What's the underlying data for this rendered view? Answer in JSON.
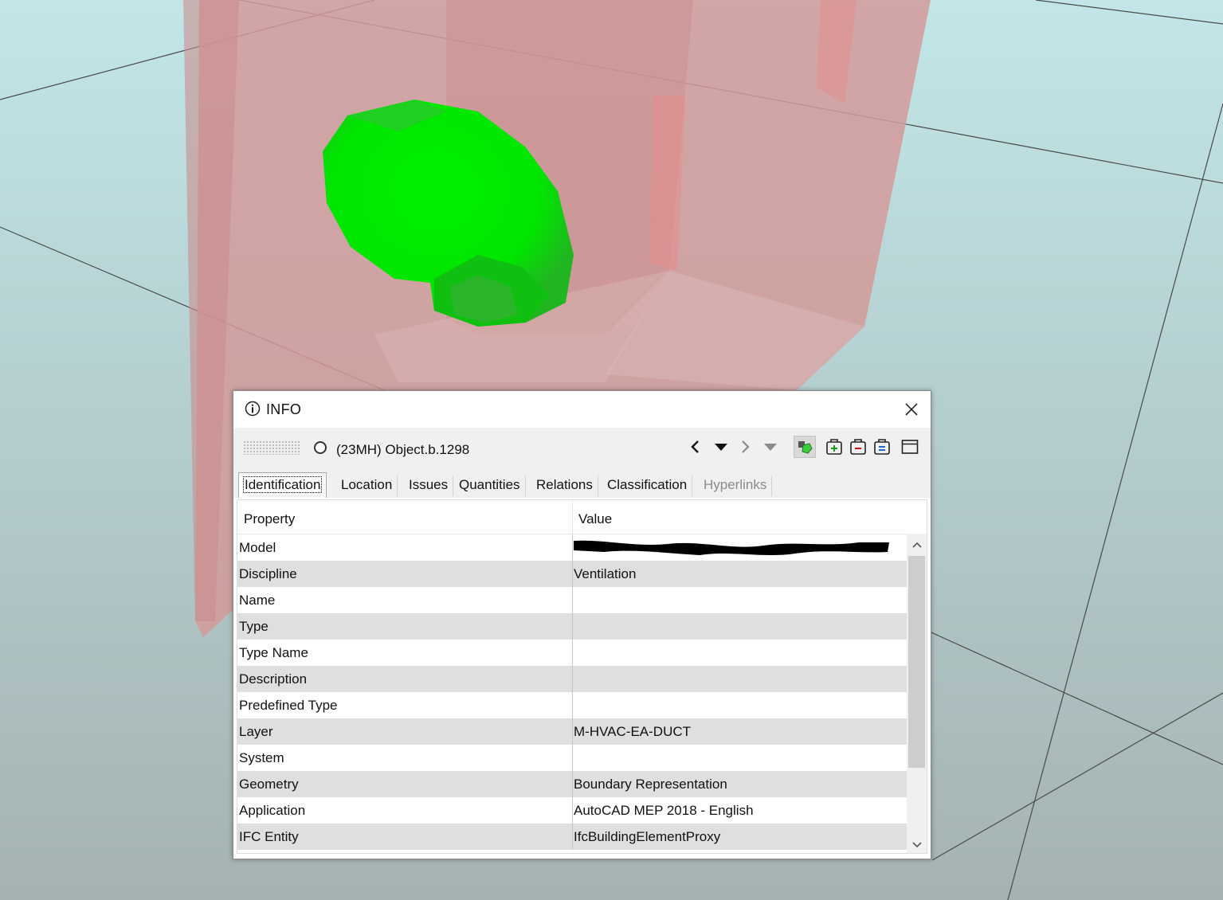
{
  "colors": {
    "sky_top": "#bfe4e6",
    "ground": "#a7b3b3",
    "wall": "#d9a0a0",
    "duct_green": "#00ee00",
    "alt_row": "#dfdfdf"
  },
  "panel": {
    "title": "INFO",
    "title_icon": "info-circle-icon",
    "object_name": "(23MH) Object.b.1298",
    "toolbar_icons": [
      "chevron-left-icon",
      "dropdown-arrow-icon",
      "chevron-right-icon",
      "dropdown-arrow-icon",
      "visibility-toggle-icon",
      "add-selection-icon",
      "remove-selection-icon",
      "list-selection-icon",
      "window-icon"
    ],
    "tabs": [
      {
        "label": "Identification",
        "state": "selected"
      },
      {
        "label": "Location",
        "state": "normal"
      },
      {
        "label": "Issues",
        "state": "normal"
      },
      {
        "label": "Quantities",
        "state": "normal"
      },
      {
        "label": "Relations",
        "state": "normal"
      },
      {
        "label": "Classification",
        "state": "normal"
      },
      {
        "label": "Hyperlinks",
        "state": "disabled"
      }
    ],
    "columns": {
      "property": "Property",
      "value": "Value"
    },
    "rows": [
      {
        "property": "Model",
        "value": ""
      },
      {
        "property": "Discipline",
        "value": "Ventilation"
      },
      {
        "property": "Name",
        "value": ""
      },
      {
        "property": "Type",
        "value": ""
      },
      {
        "property": "Type Name",
        "value": ""
      },
      {
        "property": "Description",
        "value": ""
      },
      {
        "property": "Predefined Type",
        "value": ""
      },
      {
        "property": "Layer",
        "value": "M-HVAC-EA-DUCT"
      },
      {
        "property": "System",
        "value": ""
      },
      {
        "property": "Geometry",
        "value": "Boundary Representation"
      },
      {
        "property": "Application",
        "value": "AutoCAD MEP 2018 - English"
      },
      {
        "property": "IFC Entity",
        "value": "IfcBuildingElementProxy"
      }
    ]
  }
}
